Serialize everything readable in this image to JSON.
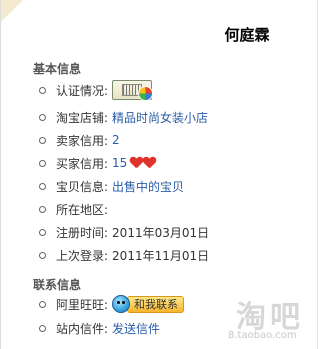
{
  "profile": {
    "name": "何庭霖"
  },
  "basic_info": {
    "title": "基本信息",
    "rows": [
      {
        "label": "认证情况:",
        "type": "badge",
        "icon": "certification-badge-icon"
      },
      {
        "label": "淘宝店铺:",
        "value": "精品时尚女装小店",
        "type": "link"
      },
      {
        "label": "卖家信用:",
        "value": "2",
        "type": "link"
      },
      {
        "label": "买家信用:",
        "value": "15",
        "type": "link-hearts",
        "hearts": 2
      },
      {
        "label": "宝贝信息:",
        "value": "出售中的宝贝",
        "type": "link"
      },
      {
        "label": "所在地区:",
        "value": "",
        "type": "text"
      },
      {
        "label": "注册时间:",
        "value": "2011年03月01日",
        "type": "text"
      },
      {
        "label": "上次登录:",
        "value": "2011年11月01日",
        "type": "text"
      }
    ]
  },
  "contact_info": {
    "title": "联系信息",
    "rows": [
      {
        "label": "阿里旺旺:",
        "button_label": "和我联系",
        "type": "wangwang"
      },
      {
        "label": "站内信件:",
        "value": "发送信件",
        "type": "link"
      }
    ]
  },
  "watermark": {
    "logo": "淘吧",
    "url": "8.taobao.com"
  },
  "colors": {
    "link": "#2a5caa",
    "heart": "#e0332b",
    "wangwang": "#f6b52c"
  }
}
